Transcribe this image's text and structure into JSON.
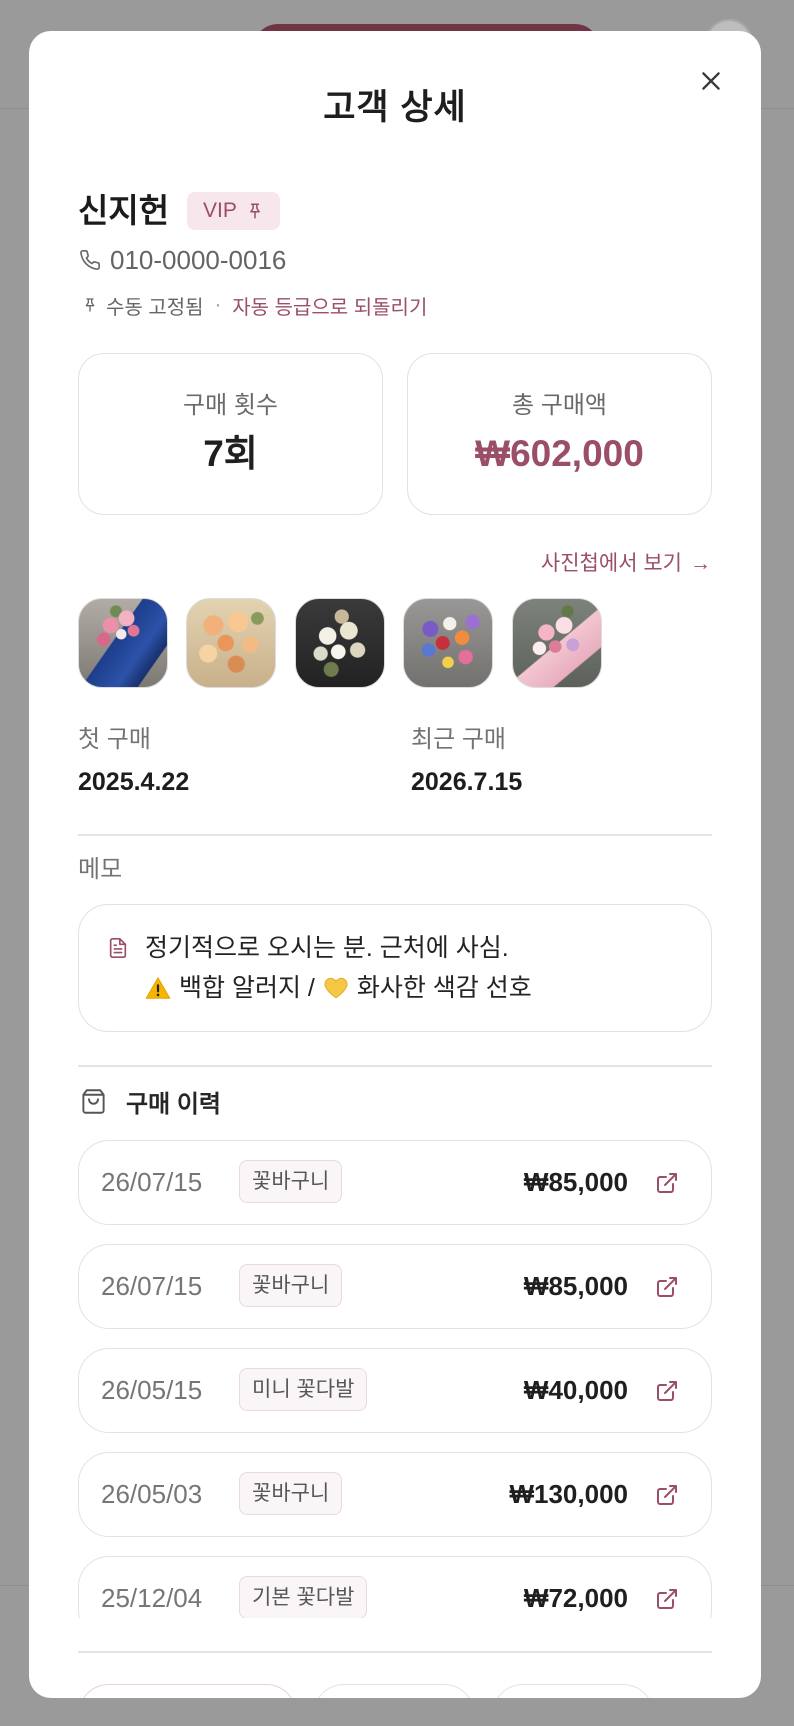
{
  "theme": {
    "accent": "#9a4e67",
    "badge_bg": "#f7e6eb",
    "tag_bg": "#faf5f6",
    "tag_border": "#ead9de",
    "backdrop": "#9a9a9a"
  },
  "modal": {
    "title": "고객 상세",
    "close_icon": "close-icon"
  },
  "customer": {
    "name": "신지헌",
    "grade": "VIP",
    "grade_icon": "pin-icon",
    "phone_icon": "phone-icon",
    "phone": "010-0000-0016",
    "pin_status": "수동 고정됨",
    "separator": "·",
    "revert_link": "자동 등급으로 되돌리기"
  },
  "stats": [
    {
      "label": "구매 횟수",
      "value": "7회"
    },
    {
      "label": "총 구매액",
      "value": "₩602,000"
    }
  ],
  "gallery": {
    "link_label": "사진첩에서 보기",
    "link_arrow": "→"
  },
  "dates": {
    "first_label": "첫 구매",
    "first_value": "2025.4.22",
    "recent_label": "최근 구매",
    "recent_value": "2026.7.15"
  },
  "memo": {
    "label": "메모",
    "icon": "document-icon",
    "line1": "정기적으로 오시는 분. 근처에 사심.",
    "line2": {
      "lead_icon": "warning-icon",
      "text_a": "백합 알러지 /",
      "mid_icon": "yellow-heart-icon",
      "text_b": "화사한 색감 선호"
    }
  },
  "history": {
    "title": "구매 이력",
    "icon": "shopping-bag-icon",
    "row_icon": "external-link-icon",
    "items": [
      {
        "date": "26/07/15",
        "product": "꽃바구니",
        "amount": "₩85,000"
      },
      {
        "date": "26/07/15",
        "product": "꽃바구니",
        "amount": "₩85,000"
      },
      {
        "date": "26/05/15",
        "product": "미니 꽃다발",
        "amount": "₩40,000"
      },
      {
        "date": "26/05/03",
        "product": "꽃바구니",
        "amount": "₩130,000"
      },
      {
        "date": "25/12/04",
        "product": "기본 꽃다발",
        "amount": "₩72,000"
      }
    ]
  }
}
